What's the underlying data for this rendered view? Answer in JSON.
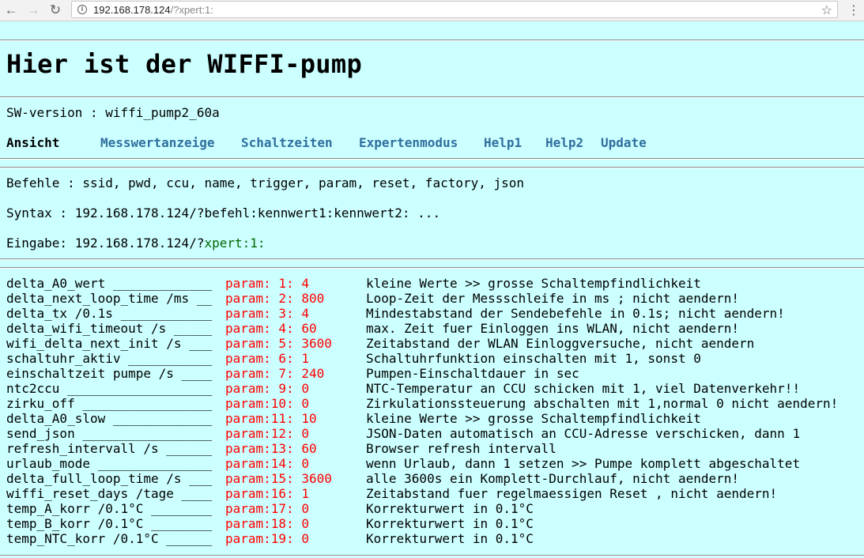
{
  "browser": {
    "url_host": "192.168.178.124",
    "url_path": "/?xpert:1:"
  },
  "page": {
    "title": "Hier ist der WIFFI-pump",
    "sw_version": "SW-version : wiffi_pump2_60a",
    "ansicht_label": "Ansicht",
    "nav": [
      "Messwertanzeige",
      "Schaltzeiten",
      "Expertenmodus",
      "Help1",
      "Help2",
      "Update"
    ],
    "befehle": "Befehle : ssid, pwd, ccu, name, trigger, param, reset, factory, json",
    "syntax": "Syntax : 192.168.178.124/?befehl:kennwert1:kennwert2: ...",
    "eingabe_prefix": "Eingabe: 192.168.178.124/?",
    "eingabe_value": "xpert:1:"
  },
  "params": [
    {
      "name": "delta_A0_wert _____________",
      "param": "param: 1: 4",
      "desc": "kleine Werte >> grosse Schaltempfindlichkeit"
    },
    {
      "name": "delta_next_loop_time /ms __",
      "param": "param: 2: 800",
      "desc": "Loop-Zeit der Messschleife in ms ; nicht aendern!"
    },
    {
      "name": "delta_tx /0.1s ____________",
      "param": "param: 3: 4",
      "desc": "Mindestabstand der Sendebefehle in 0.1s; nicht aendern!"
    },
    {
      "name": "delta_wifi_timeout /s _____",
      "param": "param: 4: 60",
      "desc": "max. Zeit fuer Einloggen ins WLAN, nicht aendern!"
    },
    {
      "name": "wifi_delta_next_init /s ___",
      "param": "param: 5: 3600",
      "desc": "Zeitabstand der WLAN Einloggversuche, nicht aendern"
    },
    {
      "name": "schaltuhr_aktiv ___________",
      "param": "param: 6: 1",
      "desc": "Schaltuhrfunktion einschalten mit 1, sonst 0"
    },
    {
      "name": "einschaltzeit pumpe /s ____",
      "param": "param: 7: 240",
      "desc": "Pumpen-Einschaltdauer in sec"
    },
    {
      "name": "ntc2ccu ___________________",
      "param": "param: 9: 0",
      "desc": "NTC-Temperatur an CCU schicken mit 1, viel Datenverkehr!!"
    },
    {
      "name": "zirku_off _________________",
      "param": "param:10: 0",
      "desc": "Zirkulationssteuerung abschalten mit 1,normal 0 nicht aendern!"
    },
    {
      "name": "delta_A0_slow _____________",
      "param": "param:11: 10",
      "desc": "kleine Werte >> grosse Schaltempfindlichkeit"
    },
    {
      "name": "send_json _________________",
      "param": "param:12: 0",
      "desc": "JSON-Daten automatisch an CCU-Adresse verschicken, dann 1"
    },
    {
      "name": "refresh_intervall /s ______",
      "param": "param:13: 60",
      "desc": "Browser refresh intervall"
    },
    {
      "name": "urlaub_mode _______________",
      "param": "param:14: 0",
      "desc": "wenn Urlaub, dann 1 setzen >> Pumpe komplett abgeschaltet"
    },
    {
      "name": "delta_full_loop_time /s ___",
      "param": "param:15: 3600",
      "desc": "alle 3600s ein Komplett-Durchlauf, nicht aendern!"
    },
    {
      "name": "wiffi_reset_days /tage ____",
      "param": "param:16: 1",
      "desc": "Zeitabstand fuer regelmaessigen Reset , nicht aendern!"
    },
    {
      "name": "temp_A_korr /0.1°C ________",
      "param": "param:17: 0",
      "desc": "Korrekturwert in 0.1°C"
    },
    {
      "name": "temp_B_korr /0.1°C ________",
      "param": "param:18: 0",
      "desc": "Korrekturwert in 0.1°C"
    },
    {
      "name": "temp_NTC_korr /0.1°C ______",
      "param": "param:19: 0",
      "desc": "Korrekturwert in 0.1°C"
    }
  ]
}
